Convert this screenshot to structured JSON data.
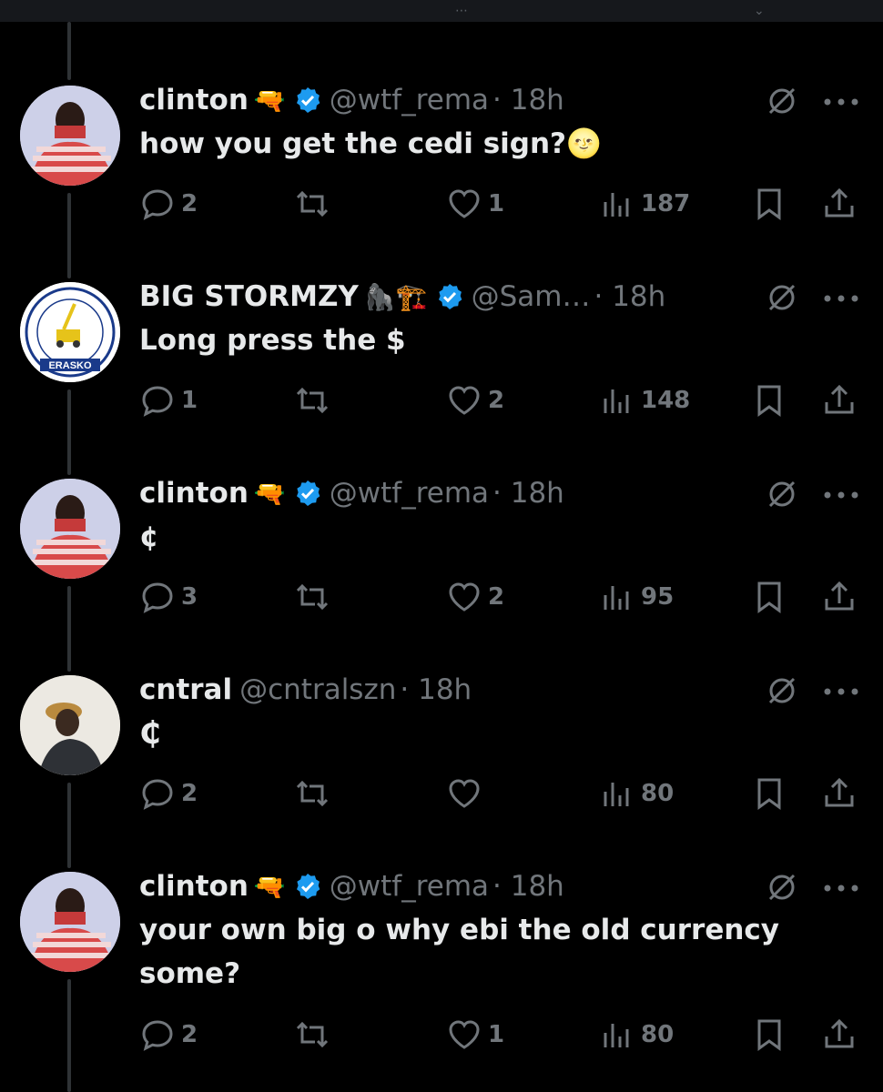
{
  "tweets": [
    {
      "name": "clinton",
      "name_emoji": "🔫",
      "verified": true,
      "handle": "@wtf_rema",
      "time": "· 18h",
      "text": "how you get the cedi sign?🌝",
      "replies": "2",
      "reposts": "",
      "likes": "1",
      "views": "187",
      "avatar": "clinton-avatar"
    },
    {
      "name": "BIG STORMZY",
      "name_emoji": "🦍🏗️",
      "verified": true,
      "handle": "@Sam…",
      "time": "· 18h",
      "text": "Long press the $",
      "replies": "1",
      "reposts": "",
      "likes": "2",
      "views": "148",
      "avatar": "erasko-logo-avatar"
    },
    {
      "name": "clinton",
      "name_emoji": "🔫",
      "verified": true,
      "handle": "@wtf_rema",
      "time": "· 18h",
      "text": "¢",
      "replies": "3",
      "reposts": "",
      "likes": "2",
      "views": "95",
      "avatar": "clinton-avatar"
    },
    {
      "name": "cntral",
      "name_emoji": "",
      "verified": false,
      "handle": "@cntralszn",
      "time": "· 18h",
      "text": "₵",
      "replies": "2",
      "reposts": "",
      "likes": "",
      "views": "80",
      "avatar": "cntral-avatar"
    },
    {
      "name": "clinton",
      "name_emoji": "🔫",
      "verified": true,
      "handle": "@wtf_rema",
      "time": "· 18h",
      "text": "your own big o why ebi the old currency some?",
      "replies": "2",
      "reposts": "",
      "likes": "1",
      "views": "80",
      "avatar": "clinton-avatar"
    }
  ],
  "colors": {
    "background": "#000000",
    "text_primary": "#e7e9ea",
    "text_secondary": "#71767b",
    "verified_blue": "#1d9bf0",
    "thread_line": "#2f3336"
  }
}
